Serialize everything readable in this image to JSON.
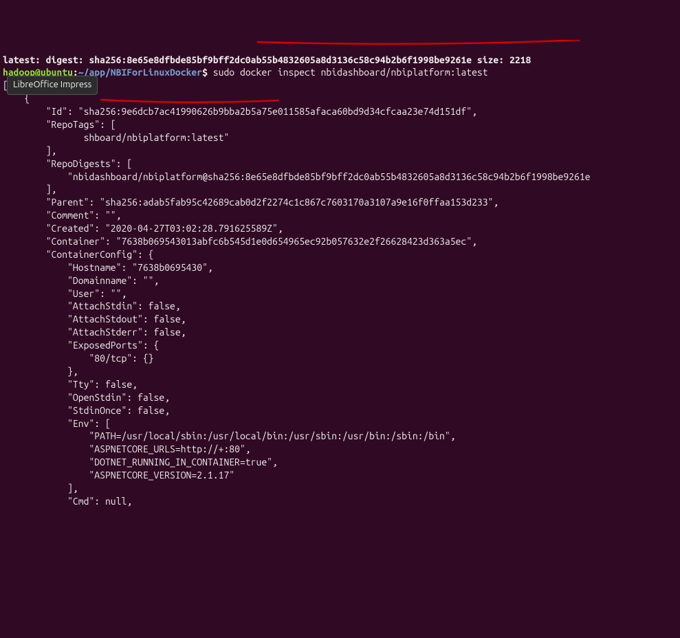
{
  "line_digest": "latest: digest: sha256:8e65e8dfbde85bf9bff2dc0ab55b4832605a8d3136c58c94b2b6f1998be9261e size: 2218",
  "prompt": {
    "user": "hadoop@ubuntu",
    "sep1": ":",
    "path": "~/app/NBIForLinuxDocker",
    "sep2": "$",
    "command": " sudo docker inspect nbidashboard/nbiplatform:latest"
  },
  "json_lines": [
    "[",
    "    {",
    "        \"Id\": \"sha256:9e6dcb7ac41990626b9bba2b5a75e011585afaca60bd9d34cfcaa23e74d151df\",",
    "        \"RepoTags\": [",
    "               shboard/nbiplatform:latest\"",
    "        ],",
    "        \"RepoDigests\": [",
    "            \"nbidashboard/nbiplatform@sha256:8e65e8dfbde85bf9bff2dc0ab55b4832605a8d3136c58c94b2b6f1998be9261e",
    "        ],",
    "        \"Parent\": \"sha256:adab5fab95c42689cab0d2f2274c1c867c7603170a3107a9e16f0ffaa153d233\",",
    "        \"Comment\": \"\",",
    "        \"Created\": \"2020-04-27T03:02:28.791625589Z\",",
    "        \"Container\": \"7638b069543013abfc6b545d1e0d654965ec92b057632e2f26628423d363a5ec\",",
    "        \"ContainerConfig\": {",
    "            \"Hostname\": \"7638b0695430\",",
    "            \"Domainname\": \"\",",
    "            \"User\": \"\",",
    "            \"AttachStdin\": false,",
    "            \"AttachStdout\": false,",
    "            \"AttachStderr\": false,",
    "            \"ExposedPorts\": {",
    "                \"80/tcp\": {}",
    "            },",
    "            \"Tty\": false,",
    "            \"OpenStdin\": false,",
    "            \"StdinOnce\": false,",
    "            \"Env\": [",
    "                \"PATH=/usr/local/sbin:/usr/local/bin:/usr/sbin:/usr/bin:/sbin:/bin\",",
    "                \"ASPNETCORE_URLS=http://+:80\",",
    "                \"DOTNET_RUNNING_IN_CONTAINER=true\",",
    "                \"ASPNETCORE_VERSION=2.1.17\"",
    "            ],",
    "            \"Cmd\": null,"
  ],
  "tooltip": "LibreOffice Impress",
  "annotation_color": "#d40000"
}
